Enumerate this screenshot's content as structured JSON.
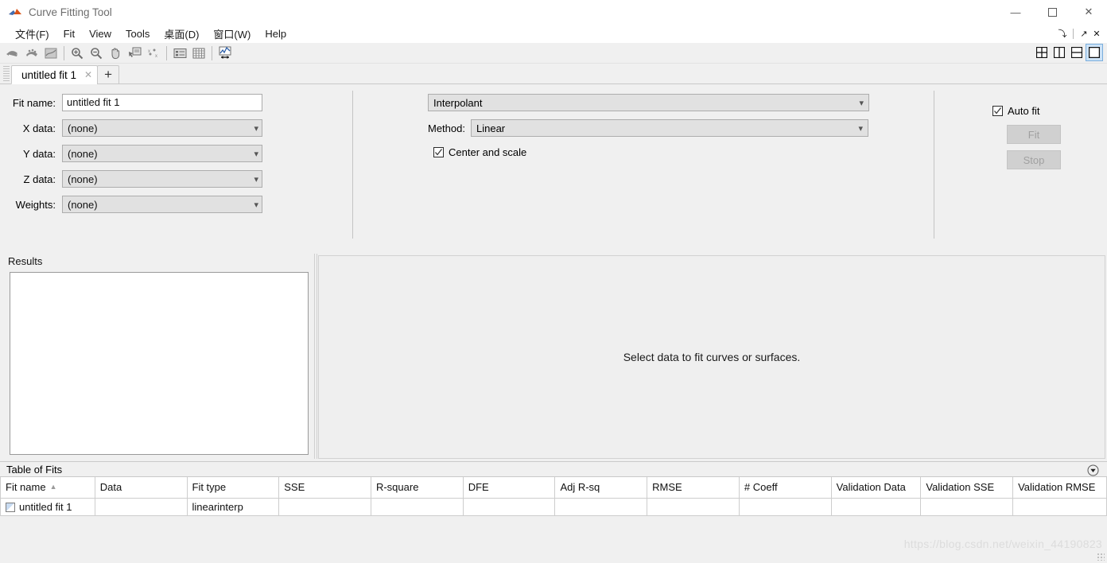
{
  "window": {
    "title": "Curve Fitting Tool",
    "icon": "matlab-curvefit-icon",
    "minimize": "—",
    "maximize": "☐",
    "close": "✕"
  },
  "menubar": {
    "items": [
      {
        "label": "文件(F)",
        "name": "menu-file"
      },
      {
        "label": "Fit",
        "name": "menu-fit"
      },
      {
        "label": "View",
        "name": "menu-view"
      },
      {
        "label": "Tools",
        "name": "menu-tools"
      },
      {
        "label": "桌面(D)",
        "name": "menu-desktop"
      },
      {
        "label": "窗口(W)",
        "name": "menu-window"
      },
      {
        "label": "Help",
        "name": "menu-help"
      }
    ],
    "dock_buttons": [
      {
        "glyph": "⤵",
        "name": "minimize-panel-button"
      },
      {
        "glyph": "↗",
        "name": "undock-button"
      },
      {
        "glyph": "✕",
        "name": "close-panel-button"
      }
    ]
  },
  "toolbar": {
    "buttons": [
      {
        "name": "fit-curve-icon",
        "tooltip": "Fit a curve"
      },
      {
        "name": "fit-surface-icon",
        "tooltip": "Fit a surface"
      },
      {
        "name": "print-to-figure-icon",
        "tooltip": "Print to figure"
      },
      {
        "name": "zoom-in-icon",
        "tooltip": "Zoom In"
      },
      {
        "name": "zoom-out-icon",
        "tooltip": "Zoom Out"
      },
      {
        "name": "pan-icon",
        "tooltip": "Pan"
      },
      {
        "name": "data-cursor-icon",
        "tooltip": "Data Cursor"
      },
      {
        "name": "exclude-outliers-icon",
        "tooltip": "Exclude outliers"
      },
      {
        "name": "legend-icon",
        "tooltip": "Legend"
      },
      {
        "name": "grid-icon",
        "tooltip": "Grid"
      },
      {
        "name": "axes-limits-icon",
        "tooltip": "Axes limits"
      }
    ],
    "layout_buttons": [
      {
        "name": "layout-quad-button",
        "selected": false
      },
      {
        "name": "layout-two-columns-button",
        "selected": false
      },
      {
        "name": "layout-two-rows-button",
        "selected": false
      },
      {
        "name": "layout-single-button",
        "selected": true
      }
    ]
  },
  "tabs": {
    "items": [
      {
        "label": "untitled fit 1",
        "active": true,
        "close": "✕"
      }
    ],
    "add_label": "+"
  },
  "fit_options": {
    "fit_name_label": "Fit name:",
    "fit_name_value": "untitled fit 1",
    "x_data_label": "X data:",
    "x_data_value": "(none)",
    "y_data_label": "Y data:",
    "y_data_value": "(none)",
    "z_data_label": "Z data:",
    "z_data_value": "(none)",
    "weights_label": "Weights:",
    "weights_value": "(none)",
    "fit_type_value": "Interpolant",
    "method_label": "Method:",
    "method_value": "Linear",
    "center_and_scale_label": "Center and scale",
    "center_and_scale_checked": true,
    "auto_fit_label": "Auto fit",
    "auto_fit_checked": true,
    "fit_button_label": "Fit",
    "stop_button_label": "Stop"
  },
  "results": {
    "title": "Results",
    "content": ""
  },
  "plot": {
    "message": "Select data to fit curves or surfaces."
  },
  "table_of_fits": {
    "title": "Table of Fits",
    "options_icon": "chevron-down-circle-icon",
    "columns": [
      "Fit name",
      "Data",
      "Fit type",
      "SSE",
      "R-square",
      "DFE",
      "Adj R-sq",
      "RMSE",
      "# Coeff",
      "Validation Data",
      "Validation SSE",
      "Validation RMSE"
    ],
    "sort_column": "Fit name",
    "sort_arrow": "▲",
    "rows": [
      {
        "fit_name": "untitled fit 1",
        "data": "",
        "fit_type": "linearinterp",
        "sse": "",
        "r_square": "",
        "dfe": "",
        "adj_r_sq": "",
        "rmse": "",
        "num_coeff": "",
        "validation_data": "",
        "validation_sse": "",
        "validation_rmse": ""
      }
    ]
  },
  "watermark": {
    "text": "https://blog.csdn.net/weixin_44190823"
  }
}
